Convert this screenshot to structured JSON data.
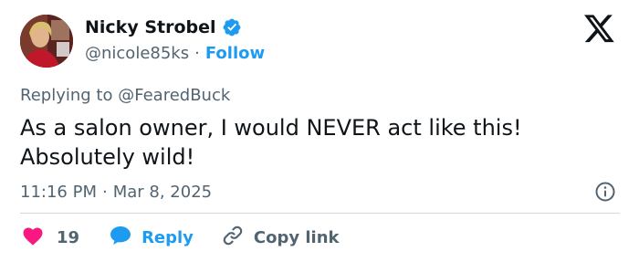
{
  "author": {
    "display_name": "Nicky Strobel",
    "handle": "@nicole85ks",
    "follow_label": "Follow",
    "separator": "·"
  },
  "reply": {
    "prefix": "Replying to",
    "mention": "@FearedBuck"
  },
  "tweet": {
    "line1": "As a salon owner, I would NEVER act like this!",
    "line2": "Absolutely wild!"
  },
  "meta": {
    "time": "11:16 PM",
    "separator": "·",
    "date": "Mar 8, 2025"
  },
  "actions": {
    "like_count": "19",
    "reply_label": "Reply",
    "copy_label": "Copy link"
  },
  "icons": {
    "verified": "verified-badge-icon",
    "logo": "x-logo-icon",
    "info": "info-icon",
    "like": "heart-icon",
    "reply": "speech-bubble-icon",
    "copy": "link-icon"
  },
  "colors": {
    "accent": "#1d9bf0",
    "like": "#f91880",
    "text": "#0f1419",
    "muted": "#536471",
    "divider": "#cfd9de"
  }
}
